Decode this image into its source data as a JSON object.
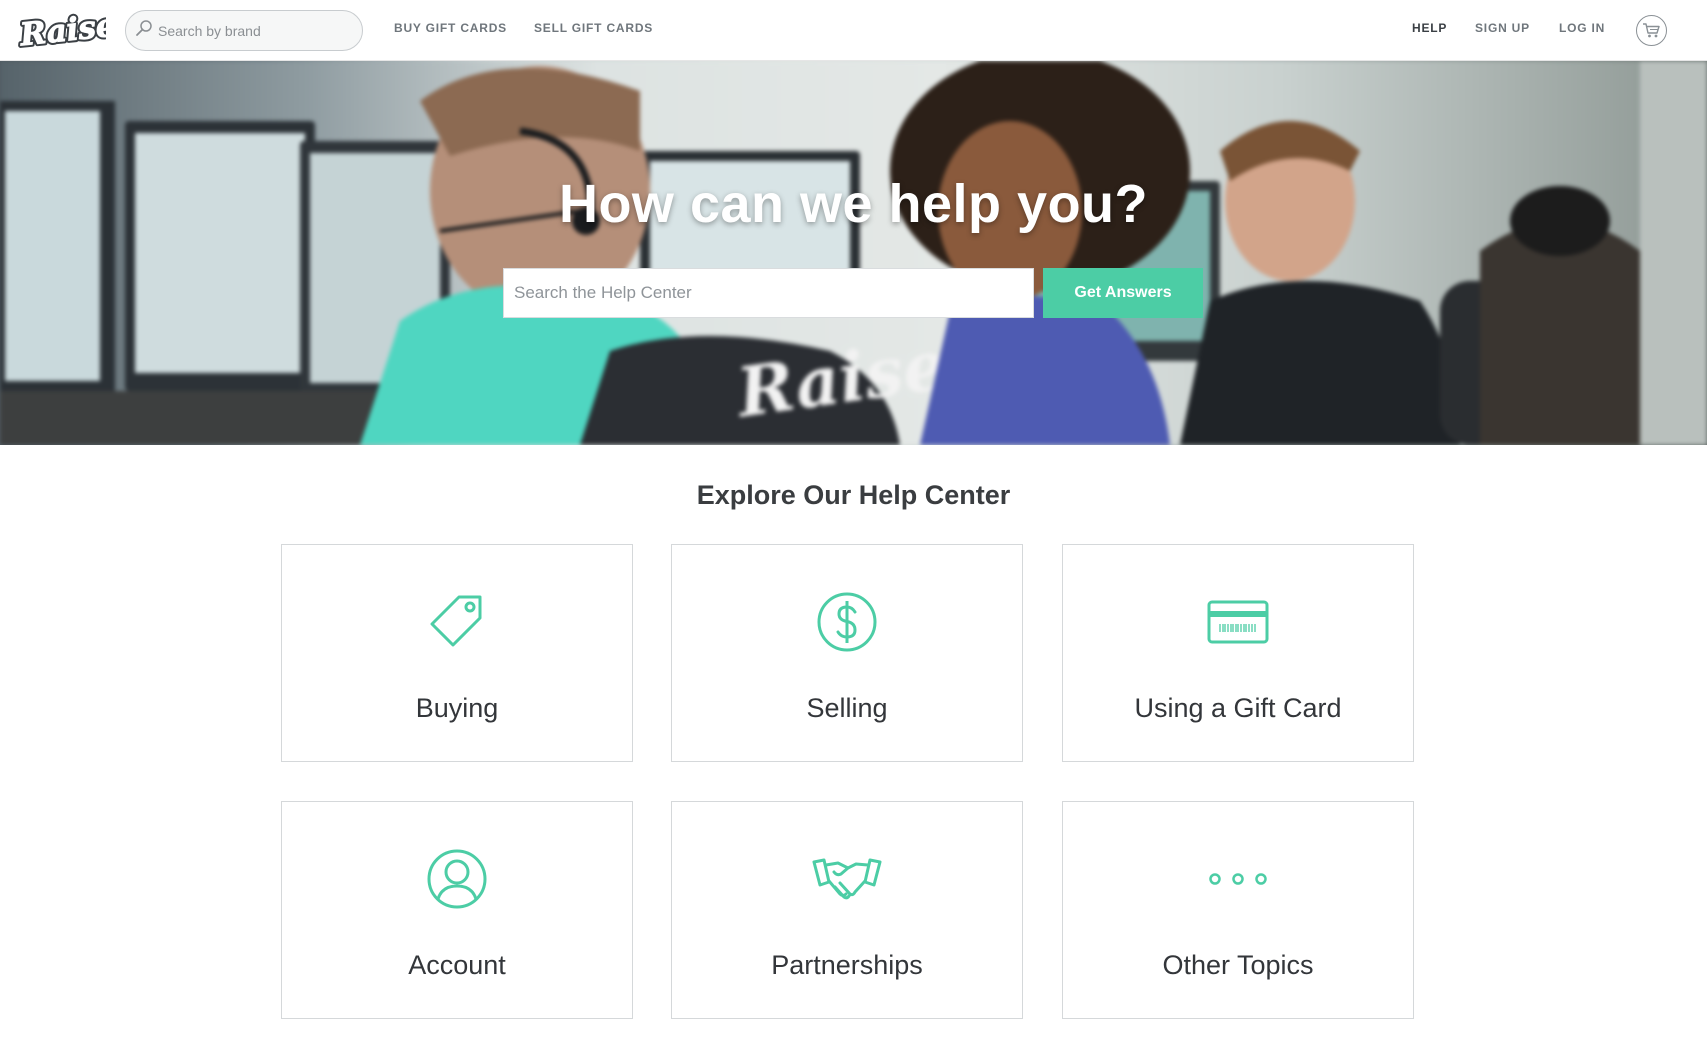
{
  "header": {
    "logo_text": "Raise",
    "brand_search_placeholder": "Search by brand",
    "nav_left": [
      {
        "label": "BUY GIFT CARDS"
      },
      {
        "label": "SELL GIFT CARDS"
      }
    ],
    "nav_right": [
      {
        "label": "HELP",
        "active": true
      },
      {
        "label": "SIGN UP"
      },
      {
        "label": "LOG IN"
      }
    ],
    "cart_icon": "shopping-cart-icon"
  },
  "hero": {
    "title": "How can we help you?",
    "search_placeholder": "Search the Help Center",
    "button_label": "Get Answers",
    "shirt_logo_text": "Raise"
  },
  "explore": {
    "title": "Explore Our Help Center",
    "cards": [
      {
        "label": "Buying",
        "icon": "price-tag-icon"
      },
      {
        "label": "Selling",
        "icon": "dollar-circle-icon"
      },
      {
        "label": "Using a Gift Card",
        "icon": "gift-card-barcode-icon"
      },
      {
        "label": "Account",
        "icon": "user-circle-icon"
      },
      {
        "label": "Partnerships",
        "icon": "handshake-icon"
      },
      {
        "label": "Other Topics",
        "icon": "more-dots-icon"
      }
    ]
  },
  "colors": {
    "accent": "#4ccda5",
    "icon_stroke": "#4ccda5",
    "nav_text": "#6f767c",
    "card_border": "#d5d8da"
  }
}
